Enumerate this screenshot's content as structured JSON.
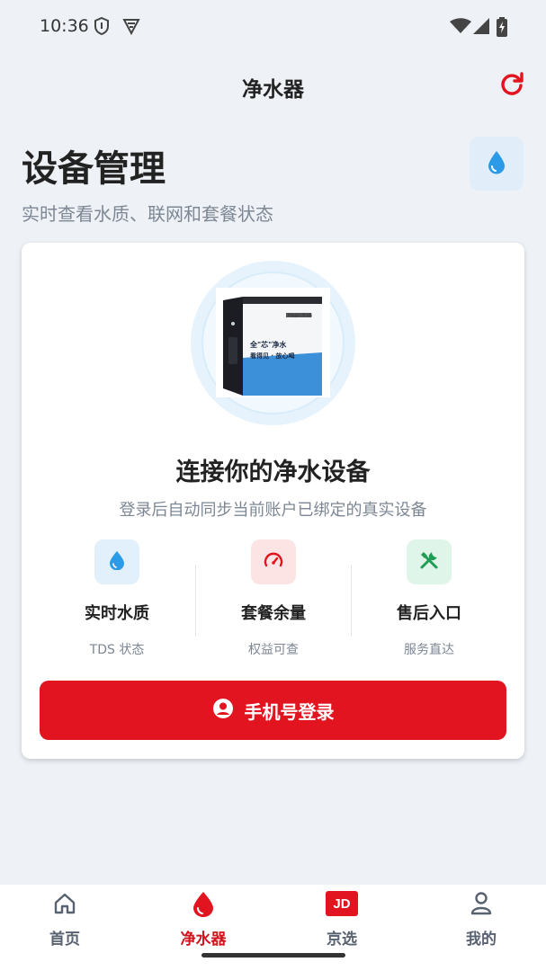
{
  "status_bar": {
    "time": "10:36",
    "left_icons": [
      "shield-status-icon",
      "vpn-status-icon"
    ],
    "right_icons": [
      "wifi-icon",
      "cellular-signal-icon",
      "battery-charging-icon"
    ]
  },
  "header": {
    "title": "净水器",
    "refresh_icon": "refresh-icon",
    "accent_color": "#e2141f"
  },
  "page": {
    "title": "设备管理",
    "subtitle": "实时查看水质、联网和套餐状态",
    "icon": "water-drop-icon"
  },
  "card": {
    "product_box": {
      "brand": "Kingpo 净水器",
      "headline_line1": "全\"芯\"净水",
      "headline_line2": "看得见 · 放心喝"
    },
    "title": "连接你的净水设备",
    "description": "登录后自动同步当前账户已绑定的真实设备",
    "features": [
      {
        "icon": "water-drop-icon",
        "title": "实时水质",
        "subtitle": "TDS 状态",
        "color": "#2b9be8"
      },
      {
        "icon": "gauge-icon",
        "title": "套餐余量",
        "subtitle": "权益可查",
        "color": "#e2141f"
      },
      {
        "icon": "tools-icon",
        "title": "售后入口",
        "subtitle": "服务直达",
        "color": "#1f9d55"
      }
    ],
    "login_button": {
      "label": "手机号登录",
      "icon": "user-circle-icon"
    }
  },
  "bottom_nav": {
    "items": [
      {
        "label": "首页",
        "icon": "home-icon",
        "active": false
      },
      {
        "label": "净水器",
        "icon": "water-drop-icon",
        "active": true
      },
      {
        "label": "京选",
        "icon": "jd-badge-icon",
        "badge": "JD",
        "active": false
      },
      {
        "label": "我的",
        "icon": "person-icon",
        "active": false
      }
    ]
  }
}
